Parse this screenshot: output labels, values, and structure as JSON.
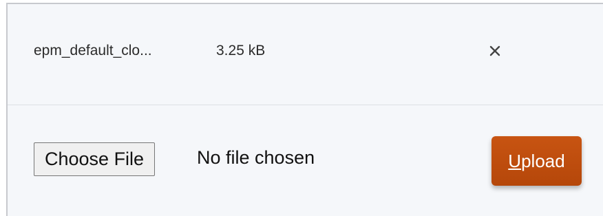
{
  "file": {
    "name": "epm_default_clo...",
    "size": "3.25 kB",
    "remove_icon": "close-icon"
  },
  "file_input": {
    "button_label": "Choose File",
    "status_text": "No file chosen"
  },
  "upload": {
    "label_mnemonic": "U",
    "label_rest": "pload",
    "color": "#c04f0e"
  }
}
